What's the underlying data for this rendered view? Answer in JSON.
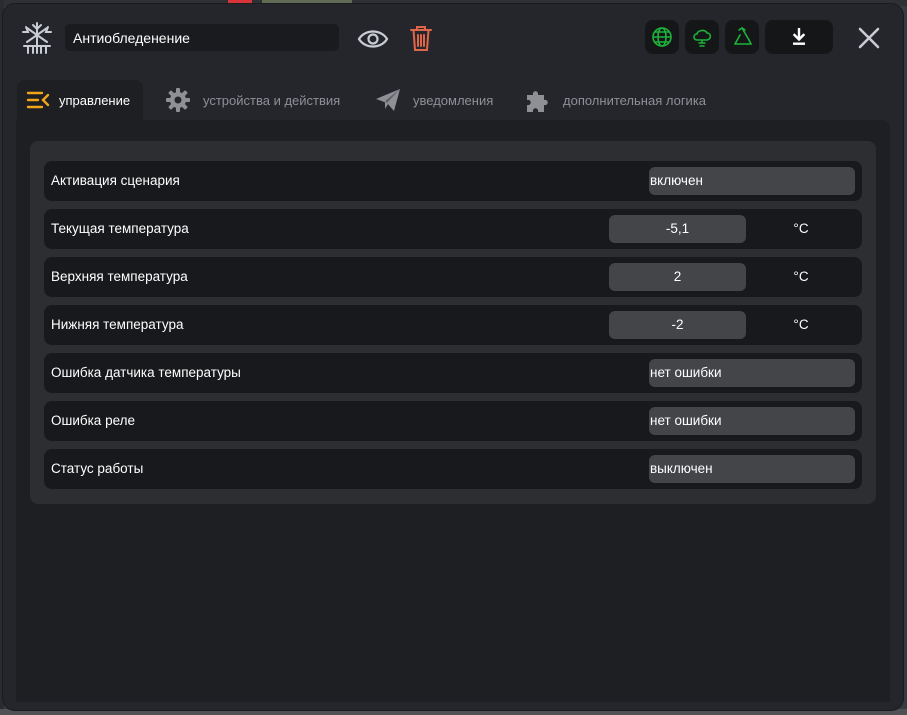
{
  "window": {
    "title": "Антиобледенение"
  },
  "header": {
    "icons": {
      "scenario": "snowflake-icon",
      "preview": "eye-icon",
      "delete": "trash-icon",
      "status_1": "globe-icon",
      "status_2": "cloud-icon",
      "status_3": "recycle-icon",
      "download": "download-icon",
      "close": "close-icon"
    },
    "colors": {
      "status_accent": "#1db33a",
      "delete_accent": "#e0664a"
    }
  },
  "tabs": [
    {
      "label": "управление",
      "icon": "control-menu-icon",
      "active": true
    },
    {
      "label": "устройства и действия",
      "icon": "gear-icon",
      "active": false
    },
    {
      "label": "уведомления",
      "icon": "paper-plane-icon",
      "active": false
    },
    {
      "label": "дополнительная логика",
      "icon": "puzzle-icon",
      "active": false
    }
  ],
  "accent_color": "#f0a51b",
  "rows": [
    {
      "label": "Активация сценария",
      "type": "select",
      "value": "включен"
    },
    {
      "label": "Текущая температура",
      "type": "number",
      "value": "-5,1",
      "unit": "°C"
    },
    {
      "label": "Верхняя температура",
      "type": "number",
      "value": "2",
      "unit": "°C"
    },
    {
      "label": "Нижняя температура",
      "type": "number",
      "value": "-2",
      "unit": "°C"
    },
    {
      "label": "Ошибка датчика температуры",
      "type": "select",
      "value": "нет ошибки"
    },
    {
      "label": "Ошибка реле",
      "type": "select",
      "value": "нет ошибки"
    },
    {
      "label": "Статус работы",
      "type": "select",
      "value": "выключен"
    }
  ]
}
